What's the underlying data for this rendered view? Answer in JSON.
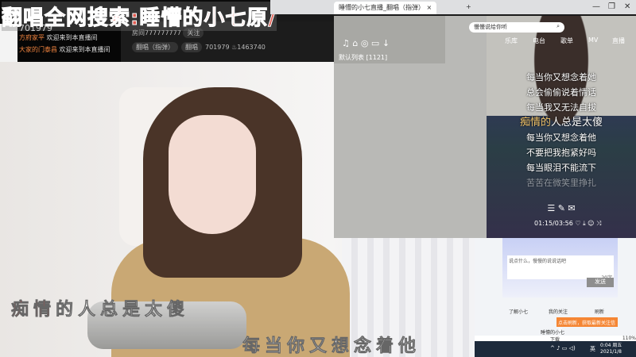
{
  "overlay_title": "翻唱全网搜索:睡懵的小七原/",
  "chat": {
    "viewer_count": "701979",
    "messages": [
      {
        "user": "方府家平",
        "text": "欢迎来到本直播间"
      },
      {
        "user": "大家的门泰昌",
        "text": "欢迎来到本直播间"
      }
    ]
  },
  "room": {
    "id": "房间777777777",
    "follow": "关注",
    "tag": "翻唱（指弹）",
    "category": "翻唱",
    "fans": "701979",
    "hot": "1463740"
  },
  "browser": {
    "tab": "睡懵的小七直播_翻唱（指弹）",
    "new_tab": "+"
  },
  "player": {
    "playlist": "默认列表 [1121]",
    "search_placeholder": "慢慢说给你听",
    "nav": [
      "乐库",
      "电台",
      "歌单",
      "MV",
      "直播"
    ],
    "time": "01:15/03:56"
  },
  "lyrics": {
    "lines": [
      "每当你又想念着她",
      "总会偷偷说着情话",
      "每当我又无法自拔",
      "每当你又想念着他",
      "不要把我抱紧好吗",
      "每当眼泪不能流下",
      "苦苦在微笑里挣扎"
    ],
    "current_hl": "痴情的",
    "current_rest": "人总是太傻"
  },
  "overlay_lyrics": {
    "line1_red": "痴情",
    "line1": "的人总是太傻",
    "line2": "每当你又想念着他"
  },
  "web": {
    "input_placeholder": "说点什么，慢慢的说说话吧",
    "char_count": "20字",
    "send": "发送",
    "tab1": "了解小七",
    "tab2": "我的关注",
    "refresh": "刷新",
    "tip": "点击刷新，获取最新关注信息",
    "streamer": "睡懵的小七",
    "zoom": "110%",
    "download": "下载"
  },
  "taskbar": {
    "time": "0:04 周五",
    "date": "2021/1/8",
    "ime": "英"
  }
}
